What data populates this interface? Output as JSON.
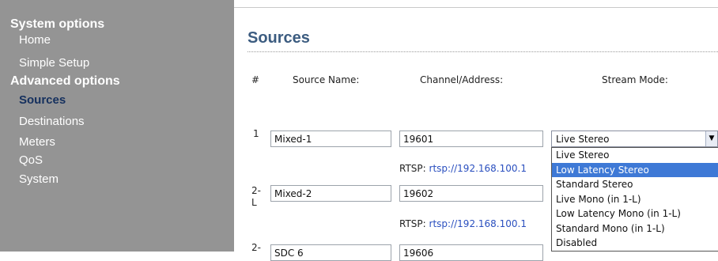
{
  "sidebar": {
    "system_options": "System options",
    "home": "Home",
    "simple_setup": "Simple Setup",
    "advanced_options": "Advanced options",
    "sources": "Sources",
    "destinations": "Destinations",
    "meters": "Meters",
    "qos": "QoS",
    "system": "System"
  },
  "page": {
    "title": "Sources"
  },
  "headers": {
    "num": "#",
    "source_name": "Source Name:",
    "channel": "Channel/Address:",
    "stream_mode": "Stream Mode:"
  },
  "rows": [
    {
      "num": "1",
      "name": "Mixed-1",
      "channel": "19601",
      "rtsp_label": "RTSP:",
      "rtsp_url": "rtsp://192.168.100.1",
      "mode": "Live Stereo"
    },
    {
      "num": "2-\nL",
      "name": "Mixed-2",
      "channel": "19602",
      "rtsp_label": "RTSP:",
      "rtsp_url": "rtsp://192.168.100.1"
    },
    {
      "num": "2-",
      "name": "SDC 6",
      "channel": "19606"
    }
  ],
  "dropdown_options": [
    "Live Stereo",
    "Low Latency Stereo",
    "Standard Stereo",
    "Live Mono (in 1-L)",
    "Low Latency Mono (in 1-L)",
    "Standard Mono (in 1-L)",
    "Disabled"
  ],
  "dropdown_highlighted": "Low Latency Stereo",
  "colors": {
    "sidebar_bg": "#949494",
    "active_nav": "#15305e",
    "title": "#3c5c80",
    "highlight": "#3e79d6",
    "link": "#2a4fbf"
  }
}
